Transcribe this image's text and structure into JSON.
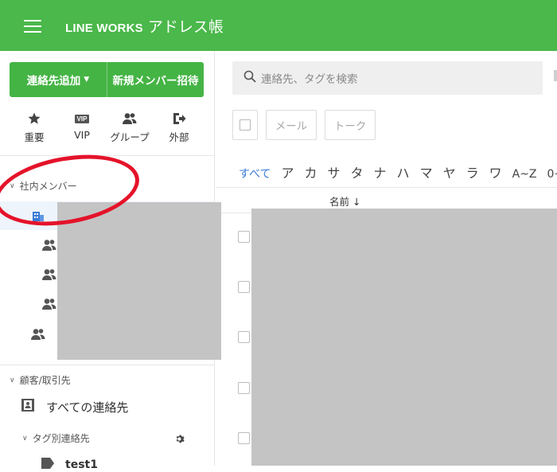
{
  "header": {
    "logo": "LINE WORKS",
    "title": "アドレス帳",
    "bg_color": "#4ab84a"
  },
  "sidebar": {
    "add_contact_label": "連絡先追加",
    "invite_member_label": "新規メンバー招待",
    "shortcuts": [
      {
        "label": "重要",
        "icon": "star-icon"
      },
      {
        "label": "VIP",
        "icon": "vip-icon",
        "badge": "VIP"
      },
      {
        "label": "グループ",
        "icon": "group-icon"
      },
      {
        "label": "外部",
        "icon": "external-icon"
      }
    ],
    "internal_section_label": "社内メンバー",
    "customers_section_label": "顧客/取引先",
    "all_contacts_label": "すべての連絡先",
    "tag_contacts_label": "タグ別連絡先",
    "tag_item_label": "test1"
  },
  "main": {
    "search_placeholder": "連絡先、タグを検索",
    "mail_button": "メール",
    "talk_button": "トーク",
    "index": [
      "すべて",
      "ア",
      "カ",
      "サ",
      "タ",
      "ナ",
      "ハ",
      "マ",
      "ヤ",
      "ラ",
      "ワ",
      "A~Z",
      "0~"
    ],
    "name_column": "名前",
    "sort_arrow": "↓"
  }
}
